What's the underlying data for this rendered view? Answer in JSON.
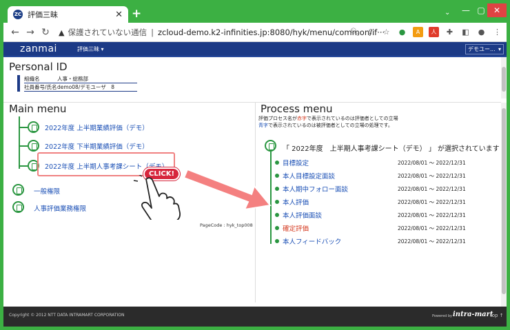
{
  "browser": {
    "tab_title": "評価三昧",
    "favicon_text": "ZC",
    "url_warning": "保護されていない通信",
    "url": "zcloud-demo.k2-infinities.jp:8080/hyk/menu/common/if···"
  },
  "nav": {
    "brand": "zanmai",
    "menu_label": "評価三昧 ▾",
    "user_label": "デモユー..."
  },
  "personal": {
    "title": "Personal ID",
    "rows": [
      {
        "label": "組織名",
        "value": "人事・総務部"
      },
      {
        "label": "社員番号/氏名",
        "value": "demo08/デモユーザ　8"
      }
    ]
  },
  "main_menu": {
    "title": "Main menu",
    "items": [
      "2022年度 上半期業績評価（デモ）",
      "2022年度 下半期業績評価（デモ）",
      "2022年度 上半期人事考課シート（デモ）"
    ],
    "extra": [
      "一般権限",
      "人事評価業務権限"
    ],
    "page_code": "PageCode : hyk_top008"
  },
  "process_menu": {
    "title": "Process menu",
    "note1": {
      "pre": "評価プロセス名が",
      "em": "赤字",
      "post": "で表示されているのは評価者としての立場"
    },
    "note2": {
      "em": "青字",
      "post": "で表示されているのは被評価者としての立場の処理です。"
    },
    "selected": "「 2022年度　上半期人事考課シート（デモ） 」 が選択されています",
    "items": [
      {
        "label": "目標設定",
        "date": "2022/08/01 ～ 2022/12/31",
        "red": false
      },
      {
        "label": "本人目標設定面談",
        "date": "2022/08/01 ～ 2022/12/31",
        "red": false
      },
      {
        "label": "本人期中フォロー面談",
        "date": "2022/08/01 ～ 2022/12/31",
        "red": false
      },
      {
        "label": "本人評価",
        "date": "2022/08/01 ～ 2022/12/31",
        "red": false
      },
      {
        "label": "本人評価面談",
        "date": "2022/08/01 ～ 2022/12/31",
        "red": false
      },
      {
        "label": "確定評価",
        "date": "2022/08/01 ～ 2022/12/31",
        "red": true
      },
      {
        "label": "本人フィードバック",
        "date": "2022/08/01 ～ 2022/12/31",
        "red": false
      }
    ]
  },
  "callout": {
    "badge": "CLICK!"
  },
  "footer": {
    "copyright": "Copyright © 2012 NTT DATA INTRAMART CORPORATION",
    "powered": "Powered by",
    "logo": "intra-mart",
    "top": "top ↑"
  },
  "colors": {
    "accent": "#1c3a86",
    "tree": "#2a9640",
    "link": "#1a4fb5",
    "red": "#d43a20",
    "window": "#3cb043"
  }
}
